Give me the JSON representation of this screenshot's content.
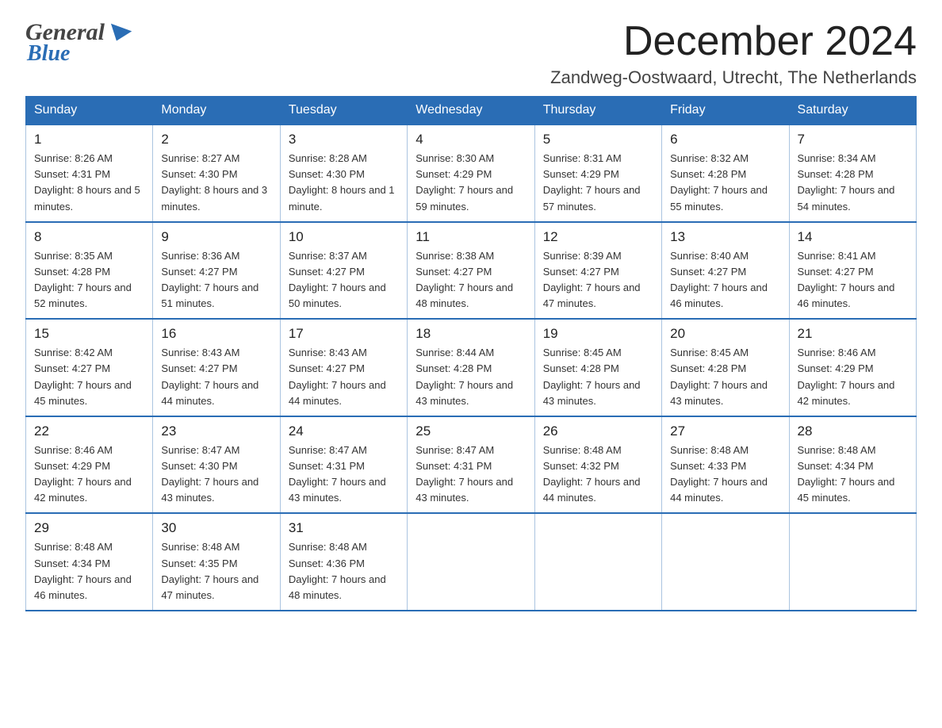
{
  "header": {
    "logo_general": "General",
    "logo_blue": "Blue",
    "main_title": "December 2024",
    "subtitle": "Zandweg-Oostwaard, Utrecht, The Netherlands"
  },
  "calendar": {
    "days_of_week": [
      "Sunday",
      "Monday",
      "Tuesday",
      "Wednesday",
      "Thursday",
      "Friday",
      "Saturday"
    ],
    "weeks": [
      [
        {
          "date": "1",
          "sunrise": "8:26 AM",
          "sunset": "4:31 PM",
          "daylight": "8 hours and 5 minutes."
        },
        {
          "date": "2",
          "sunrise": "8:27 AM",
          "sunset": "4:30 PM",
          "daylight": "8 hours and 3 minutes."
        },
        {
          "date": "3",
          "sunrise": "8:28 AM",
          "sunset": "4:30 PM",
          "daylight": "8 hours and 1 minute."
        },
        {
          "date": "4",
          "sunrise": "8:30 AM",
          "sunset": "4:29 PM",
          "daylight": "7 hours and 59 minutes."
        },
        {
          "date": "5",
          "sunrise": "8:31 AM",
          "sunset": "4:29 PM",
          "daylight": "7 hours and 57 minutes."
        },
        {
          "date": "6",
          "sunrise": "8:32 AM",
          "sunset": "4:28 PM",
          "daylight": "7 hours and 55 minutes."
        },
        {
          "date": "7",
          "sunrise": "8:34 AM",
          "sunset": "4:28 PM",
          "daylight": "7 hours and 54 minutes."
        }
      ],
      [
        {
          "date": "8",
          "sunrise": "8:35 AM",
          "sunset": "4:28 PM",
          "daylight": "7 hours and 52 minutes."
        },
        {
          "date": "9",
          "sunrise": "8:36 AM",
          "sunset": "4:27 PM",
          "daylight": "7 hours and 51 minutes."
        },
        {
          "date": "10",
          "sunrise": "8:37 AM",
          "sunset": "4:27 PM",
          "daylight": "7 hours and 50 minutes."
        },
        {
          "date": "11",
          "sunrise": "8:38 AM",
          "sunset": "4:27 PM",
          "daylight": "7 hours and 48 minutes."
        },
        {
          "date": "12",
          "sunrise": "8:39 AM",
          "sunset": "4:27 PM",
          "daylight": "7 hours and 47 minutes."
        },
        {
          "date": "13",
          "sunrise": "8:40 AM",
          "sunset": "4:27 PM",
          "daylight": "7 hours and 46 minutes."
        },
        {
          "date": "14",
          "sunrise": "8:41 AM",
          "sunset": "4:27 PM",
          "daylight": "7 hours and 46 minutes."
        }
      ],
      [
        {
          "date": "15",
          "sunrise": "8:42 AM",
          "sunset": "4:27 PM",
          "daylight": "7 hours and 45 minutes."
        },
        {
          "date": "16",
          "sunrise": "8:43 AM",
          "sunset": "4:27 PM",
          "daylight": "7 hours and 44 minutes."
        },
        {
          "date": "17",
          "sunrise": "8:43 AM",
          "sunset": "4:27 PM",
          "daylight": "7 hours and 44 minutes."
        },
        {
          "date": "18",
          "sunrise": "8:44 AM",
          "sunset": "4:28 PM",
          "daylight": "7 hours and 43 minutes."
        },
        {
          "date": "19",
          "sunrise": "8:45 AM",
          "sunset": "4:28 PM",
          "daylight": "7 hours and 43 minutes."
        },
        {
          "date": "20",
          "sunrise": "8:45 AM",
          "sunset": "4:28 PM",
          "daylight": "7 hours and 43 minutes."
        },
        {
          "date": "21",
          "sunrise": "8:46 AM",
          "sunset": "4:29 PM",
          "daylight": "7 hours and 42 minutes."
        }
      ],
      [
        {
          "date": "22",
          "sunrise": "8:46 AM",
          "sunset": "4:29 PM",
          "daylight": "7 hours and 42 minutes."
        },
        {
          "date": "23",
          "sunrise": "8:47 AM",
          "sunset": "4:30 PM",
          "daylight": "7 hours and 43 minutes."
        },
        {
          "date": "24",
          "sunrise": "8:47 AM",
          "sunset": "4:31 PM",
          "daylight": "7 hours and 43 minutes."
        },
        {
          "date": "25",
          "sunrise": "8:47 AM",
          "sunset": "4:31 PM",
          "daylight": "7 hours and 43 minutes."
        },
        {
          "date": "26",
          "sunrise": "8:48 AM",
          "sunset": "4:32 PM",
          "daylight": "7 hours and 44 minutes."
        },
        {
          "date": "27",
          "sunrise": "8:48 AM",
          "sunset": "4:33 PM",
          "daylight": "7 hours and 44 minutes."
        },
        {
          "date": "28",
          "sunrise": "8:48 AM",
          "sunset": "4:34 PM",
          "daylight": "7 hours and 45 minutes."
        }
      ],
      [
        {
          "date": "29",
          "sunrise": "8:48 AM",
          "sunset": "4:34 PM",
          "daylight": "7 hours and 46 minutes."
        },
        {
          "date": "30",
          "sunrise": "8:48 AM",
          "sunset": "4:35 PM",
          "daylight": "7 hours and 47 minutes."
        },
        {
          "date": "31",
          "sunrise": "8:48 AM",
          "sunset": "4:36 PM",
          "daylight": "7 hours and 48 minutes."
        },
        null,
        null,
        null,
        null
      ]
    ]
  }
}
